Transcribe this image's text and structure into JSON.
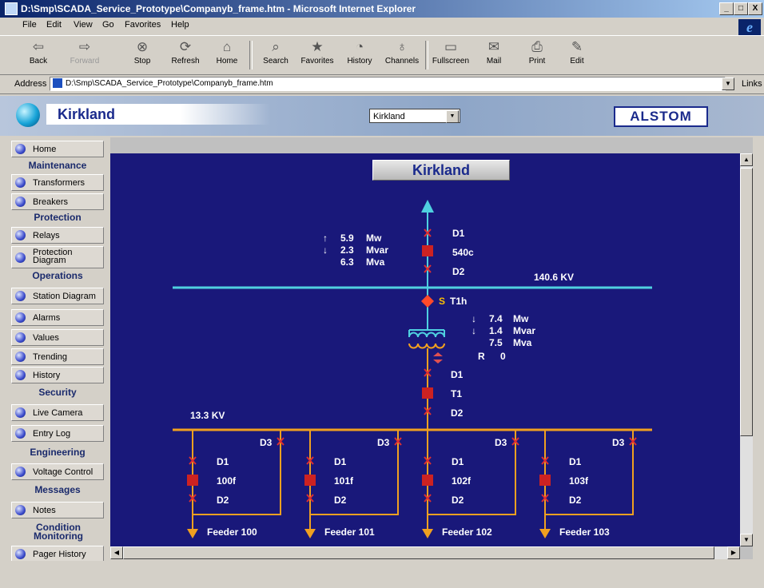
{
  "window": {
    "title": "D:\\Smp\\SCADA_Service_Prototype\\Companyb_frame.htm - Microsoft Internet Explorer",
    "min": "_",
    "max": "□",
    "close": "X"
  },
  "menu": [
    "File",
    "Edit",
    "View",
    "Go",
    "Favorites",
    "Help"
  ],
  "toolbar": {
    "back": "Back",
    "forward": "Forward",
    "stop": "Stop",
    "refresh": "Refresh",
    "home": "Home",
    "search": "Search",
    "favorites": "Favorites",
    "history": "History",
    "channels": "Channels",
    "fullscreen": "Fullscreen",
    "mail": "Mail",
    "print": "Print",
    "edit": "Edit"
  },
  "address": {
    "label": "Address",
    "url": "D:\\Smp\\SCADA_Service_Prototype\\Companyb_frame.htm",
    "links": "Links"
  },
  "header": {
    "site": "Kirkland",
    "selected_site": "Kirkland",
    "brand": "ALSTOM"
  },
  "sidebar": {
    "home": "Home",
    "maintenance": {
      "title": "Maintenance",
      "transformers": "Transformers",
      "breakers": "Breakers"
    },
    "protection": {
      "title": "Protection",
      "relays": "Relays",
      "protection_diagram": "Protection Diagram"
    },
    "operations": {
      "title": "Operations",
      "station_diagram": "Station Diagram",
      "alarms": "Alarms",
      "values": "Values",
      "trending": "Trending",
      "history": "History"
    },
    "security": {
      "title": "Security",
      "live_camera": "Live Camera",
      "entry_log": "Entry Log"
    },
    "engineering": {
      "title": "Engineering",
      "voltage_control": "Voltage Control"
    },
    "messages": {
      "title": "Messages",
      "notes": "Notes"
    },
    "condition": {
      "title": "Condition Monitoring",
      "pager_history": "Pager History"
    }
  },
  "diagram": {
    "title": "Kirkland",
    "incoming": {
      "mw": "5.9",
      "mvar": "2.3",
      "mva": "6.3",
      "top_switch": "D1",
      "breaker": "540c",
      "bottom_switch": "D2"
    },
    "hv_bus": "140.6 KV",
    "transformer": {
      "status": "S",
      "name": "T1h",
      "mw": "7.4",
      "mvar": "1.4",
      "mva": "7.5",
      "tap_label": "R",
      "tap_value": "0"
    },
    "transformer_breaker": {
      "top_switch": "D1",
      "name": "T1",
      "bottom_switch": "D2"
    },
    "lv_bus": "13.3 KV",
    "units": {
      "mw": "Mw",
      "mvar": "Mvar",
      "mva": "Mva"
    },
    "feeders": [
      {
        "breaker": "100f",
        "top": "D1",
        "bottom": "D2",
        "bypass": "D3",
        "name": "Feeder 100"
      },
      {
        "breaker": "101f",
        "top": "D1",
        "bottom": "D2",
        "bypass": "D3",
        "name": "Feeder 101"
      },
      {
        "breaker": "102f",
        "top": "D1",
        "bottom": "D2",
        "bypass": "D3",
        "name": "Feeder 102"
      },
      {
        "breaker": "103f",
        "top": "D1",
        "bottom": "D2",
        "bypass": "D3",
        "name": "Feeder 103"
      }
    ]
  },
  "colors": {
    "diagram_bg": "#19187a",
    "hv_bus": "#4fd0e0",
    "lv_bus": "#f0a020",
    "breaker": "#cc2222",
    "switch": "#e03030"
  }
}
